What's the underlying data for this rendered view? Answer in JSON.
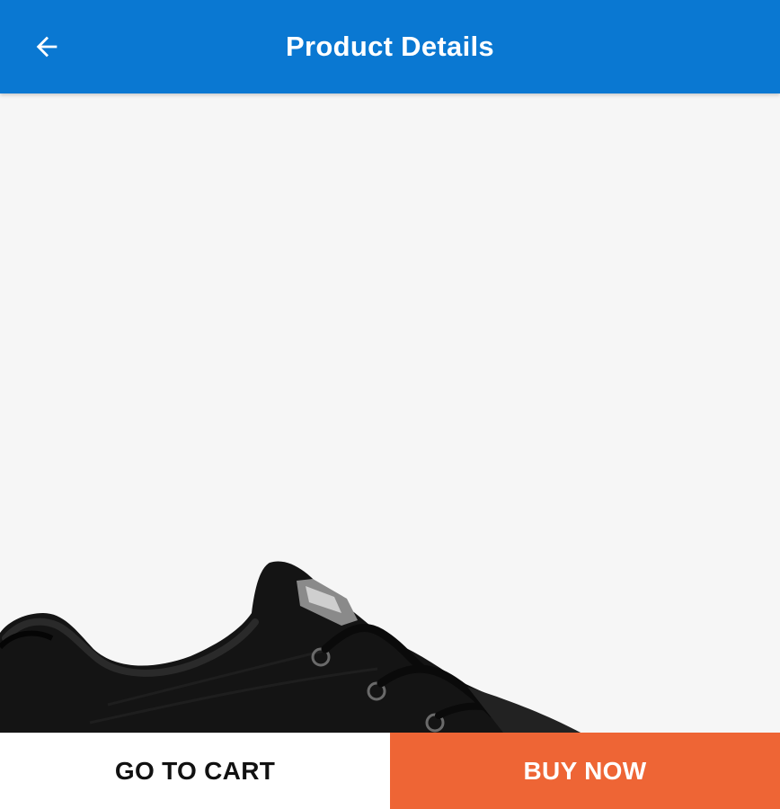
{
  "header": {
    "title": "Product Details",
    "back_icon": "arrow-left-icon",
    "background_color": "#0a78d2"
  },
  "product": {
    "image_icon": "sneaker-image",
    "image_background": "#f6f6f6"
  },
  "actions": {
    "go_to_cart_label": "GO TO CART",
    "buy_now_label": "BUY NOW",
    "buy_now_color": "#ee6535"
  }
}
